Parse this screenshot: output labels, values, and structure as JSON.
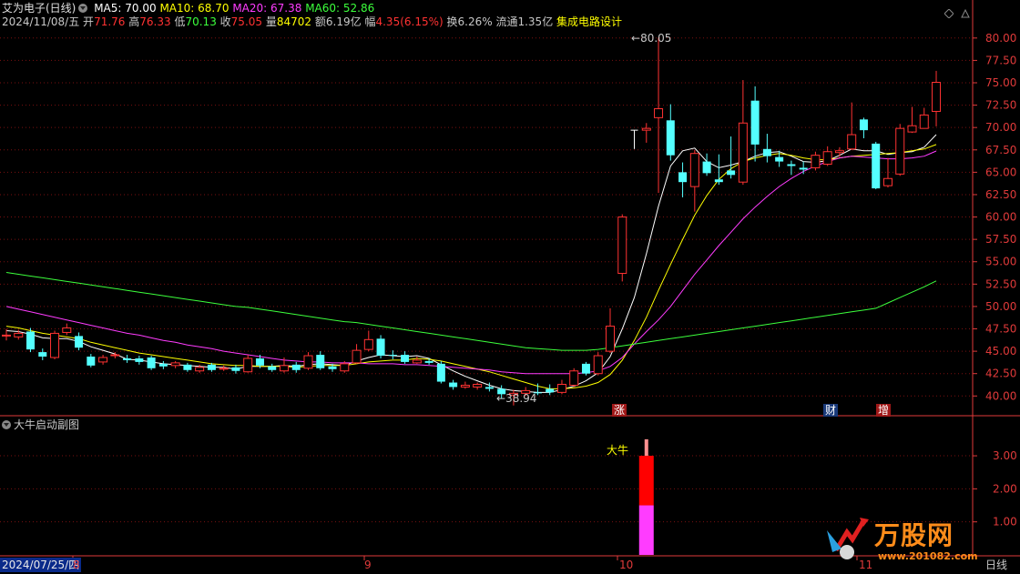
{
  "header": {
    "stock_name": "艾为电子(日线)",
    "ma5": "MA5: 70.00",
    "ma10": "MA10: 68.70",
    "ma20": "MA20: 67.38",
    "ma60": "MA60: 52.86",
    "date": "2024/11/08/五",
    "open_label": "开",
    "open": "71.76",
    "high_label": "高",
    "high": "76.33",
    "low_label": "低",
    "low": "70.13",
    "close_label": "收",
    "close": "75.05",
    "vol_label": "量",
    "vol": "84702",
    "amount_label": "额",
    "amount": "6.19亿",
    "change_label": "幅",
    "change": "4.35(6.15%)",
    "turnover": "换6.26%",
    "float": "流通1.35亿",
    "sector": "集成电路设计"
  },
  "sub_panel": {
    "title": "大牛启动副图",
    "signal_label": "大牛"
  },
  "annotations": {
    "high_mark": "80.05",
    "low_mark": "38.94"
  },
  "event_markers": {
    "zhang": "涨",
    "cai": "财",
    "zeng": "增"
  },
  "x_axis": {
    "start_date": "2024/07/25/四",
    "m8": "8",
    "m9": "9",
    "m10": "10",
    "m11": "11",
    "period": "日线"
  },
  "watermark": {
    "brand": "万股网",
    "url": "www.201082.com"
  },
  "colors": {
    "up": "#ff3232",
    "down": "#54ffff",
    "ma5": "#ffffff",
    "ma10": "#ffff00",
    "ma20": "#ff3cff",
    "ma60": "#3cff3c",
    "grid": "#7a1010",
    "axis": "#e03a3a"
  },
  "chart_data": {
    "type": "candlestick",
    "y_axis": {
      "ticks": [
        40.0,
        42.5,
        45.0,
        47.5,
        50.0,
        52.5,
        55.0,
        57.5,
        60.0,
        62.5,
        65.0,
        67.5,
        70.0,
        72.5,
        75.0,
        77.5,
        80.0
      ],
      "tick_labels": [
        "40.00",
        "42.50",
        "45.00",
        "47.50",
        "50.00",
        "52.50",
        "55.00",
        "57.50",
        "60.00",
        "62.50",
        "65.00",
        "67.50",
        "70.00",
        "72.50",
        "75.00",
        "77.50",
        "80.00"
      ],
      "ylim": [
        38.2,
        81.2
      ]
    },
    "candles": [
      [
        46.8,
        46.8,
        47.5,
        46.2
      ],
      [
        46.6,
        47.0,
        47.4,
        46.3
      ],
      [
        47.2,
        45.2,
        47.6,
        44.9
      ],
      [
        44.9,
        44.4,
        45.3,
        44.0
      ],
      [
        44.3,
        47.0,
        47.3,
        44.1
      ],
      [
        47.1,
        47.6,
        48.1,
        46.8
      ],
      [
        46.7,
        45.4,
        47.1,
        45.1
      ],
      [
        44.4,
        43.4,
        44.7,
        43.2
      ],
      [
        43.8,
        44.3,
        44.6,
        43.5
      ],
      [
        44.6,
        44.6,
        44.9,
        44.2
      ],
      [
        44.2,
        44.0,
        44.6,
        43.7
      ],
      [
        44.2,
        43.8,
        44.5,
        43.5
      ],
      [
        44.3,
        43.1,
        44.5,
        42.9
      ],
      [
        43.6,
        43.3,
        43.9,
        43.0
      ],
      [
        43.4,
        43.7,
        43.9,
        43.1
      ],
      [
        43.5,
        42.9,
        43.7,
        42.7
      ],
      [
        42.8,
        43.2,
        43.5,
        42.6
      ],
      [
        43.5,
        42.9,
        43.7,
        42.7
      ],
      [
        43.0,
        43.1,
        43.4,
        42.8
      ],
      [
        43.2,
        42.8,
        43.5,
        42.5
      ],
      [
        42.7,
        44.2,
        44.6,
        42.6
      ],
      [
        44.2,
        43.4,
        44.6,
        43.1
      ],
      [
        43.3,
        42.9,
        43.6,
        42.7
      ],
      [
        42.8,
        43.4,
        44.3,
        42.6
      ],
      [
        43.5,
        42.9,
        43.8,
        42.6
      ],
      [
        43.1,
        44.5,
        44.9,
        42.9
      ],
      [
        44.6,
        43.1,
        45.0,
        42.9
      ],
      [
        43.3,
        43.0,
        43.6,
        42.7
      ],
      [
        42.8,
        43.6,
        43.9,
        42.6
      ],
      [
        43.7,
        45.1,
        45.8,
        43.6
      ],
      [
        45.2,
        46.3,
        47.3,
        45.0
      ],
      [
        46.4,
        44.5,
        46.8,
        44.2
      ],
      [
        44.6,
        44.5,
        45.1,
        44.1
      ],
      [
        44.6,
        43.8,
        45.0,
        43.6
      ],
      [
        43.7,
        44.0,
        44.4,
        43.6
      ],
      [
        43.9,
        43.7,
        44.2,
        43.5
      ],
      [
        43.6,
        41.6,
        43.9,
        41.4
      ],
      [
        41.5,
        41.0,
        41.8,
        40.7
      ],
      [
        41.0,
        41.2,
        41.6,
        40.8
      ],
      [
        41.0,
        41.3,
        41.5,
        40.7
      ],
      [
        41.0,
        40.8,
        41.5,
        40.5
      ],
      [
        40.8,
        40.2,
        41.2,
        39.7
      ],
      [
        40.1,
        40.3,
        40.7,
        38.94
      ],
      [
        40.3,
        40.6,
        41.0,
        40.0
      ],
      [
        40.4,
        40.3,
        41.4,
        40.1
      ],
      [
        40.8,
        40.4,
        41.3,
        40.1
      ],
      [
        40.4,
        41.3,
        41.8,
        40.2
      ],
      [
        41.2,
        42.8,
        43.1,
        41.0
      ],
      [
        43.6,
        42.5,
        43.8,
        42.3
      ],
      [
        42.5,
        44.5,
        44.9,
        42.3
      ],
      [
        45.0,
        47.8,
        49.8,
        44.8
      ],
      [
        53.7,
        60.0,
        60.3,
        52.8
      ],
      [
        null,
        null,
        null,
        null
      ],
      [
        69.7,
        69.9,
        70.5,
        68.3
      ],
      [
        71.1,
        72.1,
        80.05,
        62.7
      ],
      [
        70.8,
        66.9,
        72.6,
        66.3
      ],
      [
        65.0,
        63.9,
        66.1,
        62.2
      ],
      [
        63.4,
        67.1,
        67.5,
        60.6
      ],
      [
        66.2,
        64.9,
        67.1,
        64.6
      ],
      [
        64.2,
        63.9,
        67.0,
        63.6
      ],
      [
        65.2,
        64.7,
        69.0,
        64.3
      ],
      [
        63.9,
        70.5,
        75.3,
        63.6
      ],
      [
        73.0,
        68.1,
        74.6,
        66.2
      ],
      [
        67.6,
        66.8,
        69.3,
        66.1
      ],
      [
        66.7,
        66.2,
        67.4,
        65.6
      ],
      [
        65.9,
        65.7,
        66.3,
        64.7
      ],
      [
        65.5,
        65.3,
        66.2,
        64.8
      ],
      [
        65.5,
        66.9,
        67.3,
        65.2
      ],
      [
        65.9,
        67.3,
        67.9,
        65.7
      ],
      [
        67.2,
        67.4,
        67.8,
        66.7
      ],
      [
        67.6,
        69.2,
        72.8,
        67.5
      ],
      [
        70.9,
        69.7,
        71.1,
        68.8
      ],
      [
        68.2,
        63.2,
        68.4,
        63.1
      ],
      [
        63.5,
        64.3,
        66.6,
        63.3
      ],
      [
        64.8,
        69.9,
        70.4,
        64.6
      ],
      [
        69.5,
        70.2,
        72.3,
        69.4
      ],
      [
        69.9,
        71.4,
        72.2,
        69.9
      ],
      [
        71.8,
        75.05,
        76.33,
        70.13
      ]
    ],
    "series": [
      {
        "name": "MA5",
        "values": [
          47.3,
          47.2,
          46.9,
          46.5,
          46.4,
          46.4,
          46.1,
          45.5,
          45.1,
          44.7,
          44.1,
          44.0,
          43.8,
          43.6,
          43.5,
          43.4,
          43.3,
          43.2,
          43.2,
          43.0,
          43.3,
          43.3,
          43.3,
          43.4,
          43.3,
          43.5,
          43.6,
          43.5,
          43.4,
          43.9,
          44.3,
          44.6,
          44.5,
          44.4,
          44.5,
          44.2,
          43.5,
          42.8,
          42.2,
          41.7,
          41.2,
          40.8,
          40.6,
          40.5,
          40.4,
          40.4,
          40.7,
          41.1,
          41.7,
          42.6,
          44.4,
          47.5,
          51.0,
          55.9,
          61.2,
          65.7,
          67.4,
          67.7,
          66.2,
          65.5,
          65.8,
          66.2,
          66.8,
          67.2,
          67.3,
          66.8,
          66.2,
          66.1,
          66.3,
          66.9,
          67.6,
          67.4,
          67.4,
          67.0,
          67.2,
          67.3,
          67.8,
          69.2
        ]
      },
      {
        "name": "MA10",
        "values": [
          47.8,
          47.6,
          47.3,
          47.0,
          46.8,
          46.6,
          46.4,
          46.0,
          45.7,
          45.4,
          45.1,
          44.8,
          44.6,
          44.4,
          44.2,
          44.0,
          43.8,
          43.6,
          43.5,
          43.4,
          43.4,
          43.3,
          43.3,
          43.3,
          43.2,
          43.3,
          43.4,
          43.4,
          43.4,
          43.6,
          43.8,
          43.9,
          44.0,
          44.0,
          44.2,
          44.1,
          43.9,
          43.6,
          43.3,
          43.0,
          42.7,
          42.3,
          41.9,
          41.5,
          41.1,
          40.8,
          40.8,
          40.9,
          41.1,
          41.5,
          42.4,
          44.0,
          46.2,
          48.8,
          51.8,
          54.7,
          57.5,
          60.2,
          62.4,
          64.2,
          65.4,
          66.2,
          66.6,
          66.9,
          67.1,
          66.9,
          66.6,
          66.4,
          66.4,
          66.6,
          66.8,
          66.9,
          67.0,
          67.1,
          67.2,
          67.4,
          67.6,
          68.1
        ]
      },
      {
        "name": "MA20",
        "values": [
          50.0,
          49.7,
          49.4,
          49.1,
          48.8,
          48.5,
          48.2,
          47.9,
          47.6,
          47.3,
          47.0,
          46.8,
          46.5,
          46.2,
          46.0,
          45.7,
          45.5,
          45.3,
          45.0,
          44.8,
          44.6,
          44.4,
          44.2,
          44.0,
          43.9,
          43.8,
          43.8,
          43.7,
          43.7,
          43.7,
          43.6,
          43.6,
          43.6,
          43.5,
          43.5,
          43.4,
          43.3,
          43.2,
          43.1,
          43.0,
          42.9,
          42.7,
          42.6,
          42.5,
          42.5,
          42.5,
          42.5,
          42.5,
          42.6,
          42.8,
          43.3,
          44.3,
          45.8,
          47.2,
          48.5,
          50.0,
          51.8,
          53.6,
          55.2,
          56.8,
          58.3,
          59.8,
          61.1,
          62.3,
          63.4,
          64.3,
          65.1,
          65.7,
          66.2,
          66.6,
          66.8,
          66.7,
          66.6,
          66.5,
          66.5,
          66.6,
          66.8,
          67.38
        ]
      },
      {
        "name": "MA60",
        "values": [
          53.8,
          53.6,
          53.4,
          53.2,
          53.0,
          52.8,
          52.6,
          52.4,
          52.2,
          52.0,
          51.8,
          51.6,
          51.4,
          51.2,
          51.0,
          50.8,
          50.6,
          50.4,
          50.2,
          50.0,
          49.9,
          49.7,
          49.5,
          49.3,
          49.1,
          48.9,
          48.7,
          48.5,
          48.3,
          48.2,
          48.0,
          47.8,
          47.6,
          47.4,
          47.2,
          47.0,
          46.8,
          46.6,
          46.4,
          46.2,
          46.0,
          45.8,
          45.6,
          45.4,
          45.3,
          45.2,
          45.1,
          45.1,
          45.1,
          45.2,
          45.4,
          45.6,
          45.8,
          46.0,
          46.2,
          46.4,
          46.6,
          46.8,
          47.0,
          47.2,
          47.4,
          47.6,
          47.8,
          48.0,
          48.2,
          48.4,
          48.6,
          48.8,
          49.0,
          49.2,
          49.4,
          49.6,
          49.8,
          50.4,
          51.0,
          51.6,
          52.2,
          52.86
        ]
      }
    ],
    "sub_chart": {
      "type": "bar",
      "y_ticks": [
        1.0,
        2.0,
        3.0
      ],
      "tick_labels": [
        "1.00",
        "2.00",
        "3.00"
      ],
      "ylim": [
        0,
        3.8
      ],
      "bars": [
        {
          "index": 53,
          "from": 0,
          "to": 1.5,
          "color": "#ff3cff"
        },
        {
          "index": 53,
          "from": 1.5,
          "to": 3.0,
          "color": "#ff0000"
        },
        {
          "index": 53,
          "from": 3.0,
          "to": 3.5,
          "color": "#ff9090"
        }
      ]
    }
  }
}
